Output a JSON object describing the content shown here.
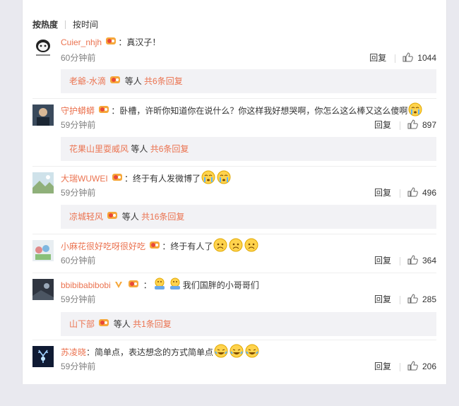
{
  "sort_tabs": {
    "hot": "按热度",
    "time": "按时间"
  },
  "reply_label": "回复",
  "comments": [
    {
      "user": "Cuier_nhjh",
      "text": "：真汉子！",
      "time": "60分钟前",
      "likes": "1044",
      "subreply": {
        "user": "老爺-水滴",
        "mid": "等人",
        "count": "共6条回复"
      }
    },
    {
      "user": "守护蟒蟒",
      "text": "：卧槽，许昕你知道你在说什么？你这样我好想哭啊，你怎么这么棒又这么傻啊",
      "time": "59分钟前",
      "likes": "897",
      "subreply": {
        "user": "花果山里耍威风",
        "mid": "等人",
        "count": "共6条回复"
      }
    },
    {
      "user": "大瑞WUWEI",
      "text": "：终于有人发微博了",
      "time": "59分钟前",
      "likes": "496",
      "subreply": {
        "user": "凉城轻风",
        "mid": "等人",
        "count": "共16条回复"
      }
    },
    {
      "user": "小麻花很好吃呀很好吃",
      "text": "：终于有人了",
      "time": "60分钟前",
      "likes": "364"
    },
    {
      "user": "bbibibabibobi",
      "text": "我们国胖的小哥哥们",
      "time": "59分钟前",
      "likes": "285",
      "subreply": {
        "user": "山下部",
        "mid": "等人",
        "count": "共1条回复"
      }
    },
    {
      "user": "苏凌晓",
      "text": "：简单点，表达想念的方式简单点",
      "time": "59分钟前",
      "likes": "206"
    }
  ],
  "colors": {
    "accent": "#eb7350",
    "reply_bg": "#f2f2f5",
    "page_bg": "#e9e9ef"
  }
}
